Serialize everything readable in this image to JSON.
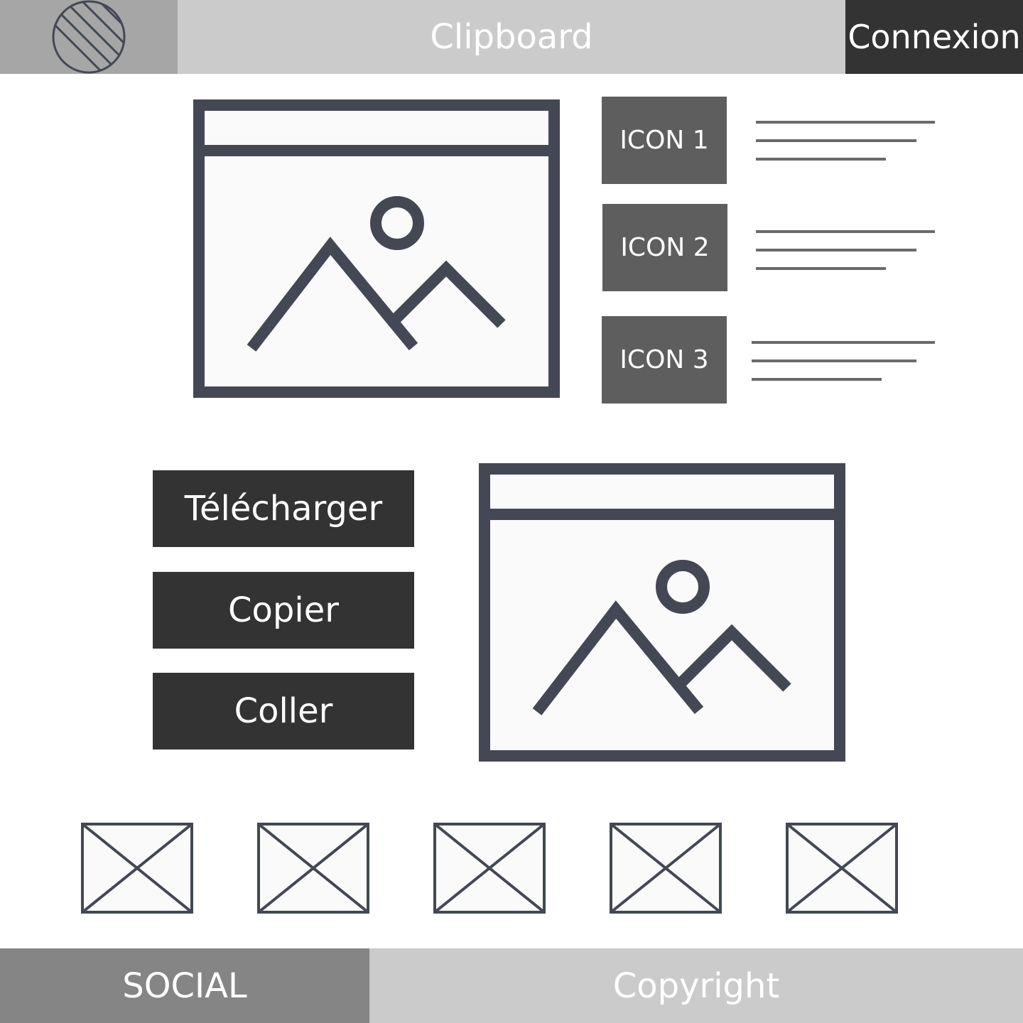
{
  "header": {
    "logo_icon": "logo-hatched-circle-icon",
    "title": "Clipboard",
    "login_label": "Connexion"
  },
  "features": [
    {
      "label": "ICON 1"
    },
    {
      "label": "ICON 2"
    },
    {
      "label": "ICON 3"
    }
  ],
  "actions": {
    "download_label": "Télécharger",
    "copy_label": "Copier",
    "paste_label": "Coller"
  },
  "gallery": {
    "thumbnail_icon": "image-placeholder-x-icon"
  },
  "footer": {
    "social_label": "SOCIAL",
    "copyright_label": "Copyright"
  },
  "colors": {
    "dark": "#333333",
    "icon_box": "#5e5e5e",
    "logo_bg": "#a6a6a6",
    "bar_bg": "#cbcbcb",
    "social_bg": "#858585",
    "stroke": "#434854"
  }
}
